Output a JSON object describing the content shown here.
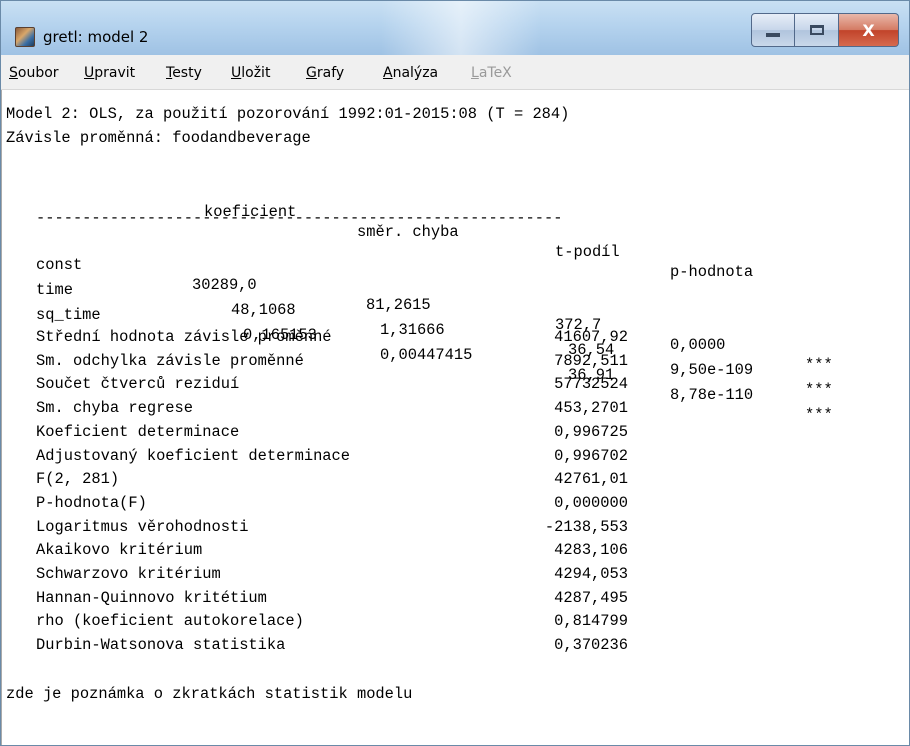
{
  "window": {
    "title": "gretl: model 2",
    "icon": "gretl-app-icon",
    "controls": {
      "minimize": "minimize-icon",
      "maximize": "maximize-icon",
      "close_glyph": "X"
    }
  },
  "menubar": {
    "items": [
      {
        "label": "Soubor",
        "underline": "S",
        "rest": "oubor",
        "enabled": true
      },
      {
        "label": "Upravit",
        "underline": "U",
        "rest": "pravit",
        "enabled": true
      },
      {
        "label": "Testy",
        "underline": "T",
        "rest": "esty",
        "enabled": true
      },
      {
        "label": "Uložit",
        "underline": "U",
        "rest": "ložit",
        "enabled": true
      },
      {
        "label": "Grafy",
        "underline": "G",
        "rest": "rafy",
        "enabled": true
      },
      {
        "label": "Analýza",
        "underline": "A",
        "rest": "nalýza",
        "enabled": true
      },
      {
        "label": "LaTeX",
        "underline": "L",
        "rest": "aTeX",
        "enabled": false
      }
    ]
  },
  "output": {
    "header_line1": "Model 2: OLS, za použití pozorování 1992:01-2015:08 (T = 284)",
    "header_line2": "Závisle proměnná: foodandbeverage",
    "table_header": {
      "coef": "koeficient",
      "stderr": "směr. chyba",
      "tratio": "t-podíl",
      "pvalue": "p-hodnota"
    },
    "separator": "---------------------------------------------------------",
    "rows": [
      {
        "name": "const",
        "coef": "30289,0",
        "stderr": "81,2615",
        "tratio": "372,7",
        "pvalue": "0,0000",
        "stars": "***"
      },
      {
        "name": "time",
        "coef": "48,1068",
        "stderr": "1,31666",
        "tratio": "36,54",
        "pvalue": "9,50e-109",
        "stars": "***"
      },
      {
        "name": "sq_time",
        "coef": "0,165153",
        "stderr": "0,00447415",
        "tratio": "36,91",
        "pvalue": "8,78e-110",
        "stars": "***"
      }
    ],
    "stats": [
      {
        "label": "Střední hodnota závisle proměnné",
        "value": "41607,92"
      },
      {
        "label": "Sm. odchylka závisle proměnné",
        "value": "7892,511"
      },
      {
        "label": "Součet čtverců reziduí",
        "value": "57732524"
      },
      {
        "label": "Sm. chyba regrese",
        "value": "453,2701"
      },
      {
        "label": "Koeficient determinace",
        "value": "0,996725"
      },
      {
        "label": "Adjustovaný koeficient determinace",
        "value": "0,996702"
      },
      {
        "label": "F(2, 281)",
        "value": "42761,01"
      },
      {
        "label": "P-hodnota(F)",
        "value": "0,000000"
      },
      {
        "label": "Logaritmus věrohodnosti",
        "value": "-2138,553"
      },
      {
        "label": "Akaikovo kritérium",
        "value": "4283,106"
      },
      {
        "label": "Schwarzovo kritérium",
        "value": "4294,053"
      },
      {
        "label": "Hannan-Quinnovo kritétium",
        "value": "4287,495"
      },
      {
        "label": "rho (koeficient autokorelace)",
        "value": "0,814799"
      },
      {
        "label": "Durbin-Watsonova statistika",
        "value": "0,370236"
      }
    ],
    "footer_note": "zde je poznámka o zkratkách statistik modelu"
  }
}
